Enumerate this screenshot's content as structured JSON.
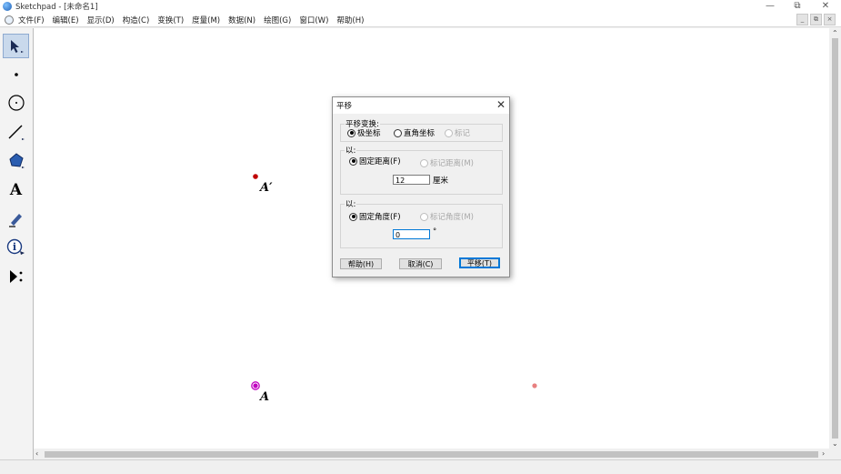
{
  "app": {
    "title": "Sketchpad - [未命名1]",
    "window_controls": {
      "minimize": "—",
      "restore": "⧉",
      "close": "✕"
    }
  },
  "menu": {
    "items": [
      "文件(F)",
      "编辑(E)",
      "显示(D)",
      "构造(C)",
      "变换(T)",
      "度量(M)",
      "数据(N)",
      "绘图(G)",
      "窗口(W)",
      "帮助(H)"
    ],
    "mdi_controls": [
      "_",
      "⧉",
      "×"
    ]
  },
  "toolbox": {
    "tools": [
      {
        "name": "arrow-tool",
        "icon": "arrow-icon",
        "selected": true
      },
      {
        "name": "point-tool",
        "icon": "point-icon"
      },
      {
        "name": "compass-tool",
        "icon": "circle-icon"
      },
      {
        "name": "straightedge-tool",
        "icon": "line-icon"
      },
      {
        "name": "polygon-tool",
        "icon": "polygon-icon"
      },
      {
        "name": "text-tool",
        "icon": "text-icon",
        "glyph": "A"
      },
      {
        "name": "marker-tool",
        "icon": "marker-icon"
      },
      {
        "name": "information-tool",
        "icon": "info-icon",
        "glyph": "i"
      },
      {
        "name": "custom-tool",
        "icon": "custom-tool-icon",
        "glyph": "▶⁝"
      }
    ]
  },
  "canvas": {
    "points": [
      {
        "label": "A′",
        "color": "#c00000"
      },
      {
        "label": "A",
        "color": "#c000c0"
      },
      {
        "label": "",
        "color": "#e88080"
      }
    ]
  },
  "dialog": {
    "title": "平移",
    "close": "✕",
    "transform_group": {
      "label": "平移变换:",
      "options": [
        {
          "label": "极坐标",
          "checked": true,
          "disabled": false
        },
        {
          "label": "直角坐标",
          "checked": false,
          "disabled": false
        },
        {
          "label": "标记",
          "checked": false,
          "disabled": true
        }
      ]
    },
    "distance_group": {
      "label": "以:",
      "options": [
        {
          "label": "固定距离(F)",
          "checked": true,
          "disabled": false
        },
        {
          "label": "标记距离(M)",
          "checked": false,
          "disabled": true
        }
      ],
      "value": "12",
      "unit": "厘米"
    },
    "angle_group": {
      "label": "以:",
      "options": [
        {
          "label": "固定角度(F)",
          "checked": true,
          "disabled": false
        },
        {
          "label": "标记角度(M)",
          "checked": false,
          "disabled": true
        }
      ],
      "value": "0",
      "unit": "°"
    },
    "buttons": {
      "help": "帮助(H)",
      "cancel": "取消(C)",
      "translate": "平移(T)"
    }
  },
  "colors": {
    "accent": "#0078d7",
    "selected_tool": "#c9d9ec"
  }
}
